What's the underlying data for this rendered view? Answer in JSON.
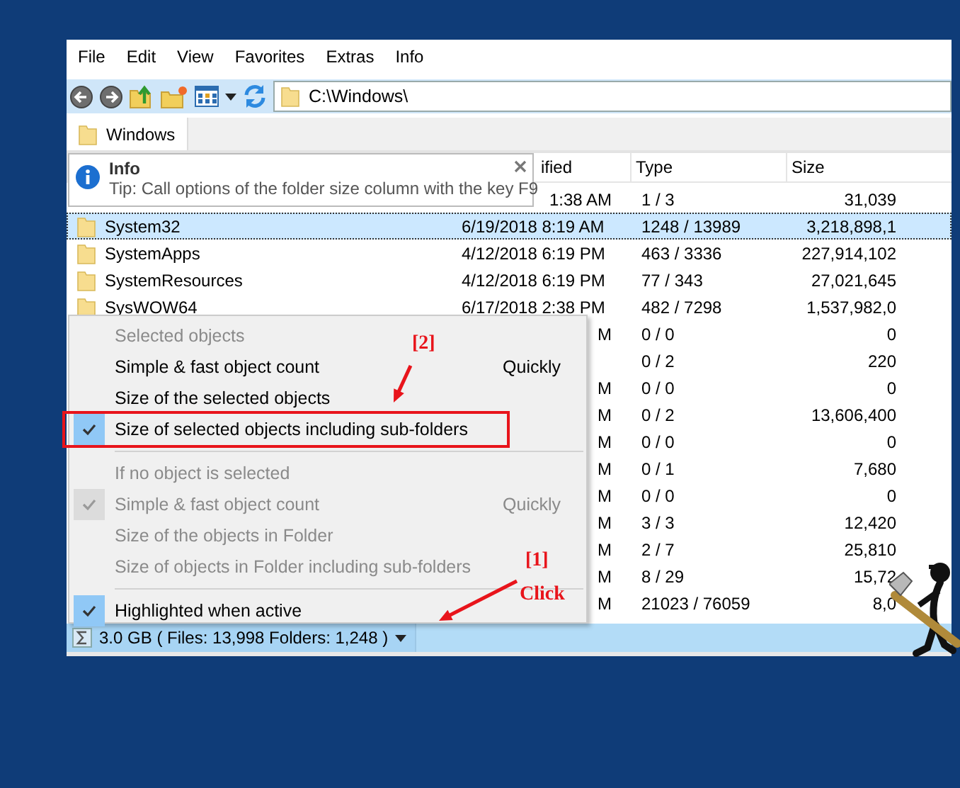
{
  "menu_bar": [
    {
      "label": "File"
    },
    {
      "label": "Edit"
    },
    {
      "label": "View"
    },
    {
      "label": "Favorites"
    },
    {
      "label": "Extras"
    },
    {
      "label": "Info"
    }
  ],
  "address_bar": {
    "value": "C:\\Windows\\"
  },
  "tabs": [
    {
      "label": "Windows",
      "selected": true
    }
  ],
  "info_tip": {
    "title": "Info",
    "text": "Tip: Call options of the folder size column with the key F9"
  },
  "file_list": {
    "columns": [
      {
        "label": "ified"
      },
      {
        "label": "Type"
      },
      {
        "label": "Size"
      }
    ],
    "rows": [
      {
        "kind": "covered",
        "modified": "1:38 AM",
        "type": "1 / 3",
        "size": "31,039",
        "selected": false
      },
      {
        "kind": "full",
        "name": "System32",
        "modified": "6/19/2018 8:19 AM",
        "type": "1248 / 13989",
        "size": "3,218,898,1",
        "selected": true
      },
      {
        "kind": "full",
        "name": "SystemApps",
        "modified": "4/12/2018 6:19 PM",
        "type": "463 / 3336",
        "size": "227,914,102",
        "selected": false
      },
      {
        "kind": "full",
        "name": "SystemResources",
        "modified": "4/12/2018 6:19 PM",
        "type": "77 / 343",
        "size": "27,021,645",
        "selected": false
      },
      {
        "kind": "full",
        "name": "SysWOW64",
        "modified": "6/17/2018 2:38 PM",
        "type": "482 / 7298",
        "size": "1,537,982,0",
        "selected": false
      },
      {
        "kind": "covered",
        "modified": "M",
        "type": "0 / 0",
        "size": "0",
        "selected": false
      },
      {
        "kind": "covered",
        "type": "0 / 2",
        "size": "220",
        "selected": false
      },
      {
        "kind": "covered",
        "modified": "M",
        "type": "0 / 0",
        "size": "0",
        "selected": false
      },
      {
        "kind": "covered",
        "modified": "M",
        "type": "0 / 2",
        "size": "13,606,400",
        "selected": false
      },
      {
        "kind": "covered",
        "modified": "M",
        "type": "0 / 0",
        "size": "0",
        "selected": false
      },
      {
        "kind": "covered",
        "modified": "M",
        "type": "0 / 1",
        "size": "7,680",
        "selected": false
      },
      {
        "kind": "covered",
        "modified": "M",
        "type": "0 / 0",
        "size": "0",
        "selected": false
      },
      {
        "kind": "covered",
        "modified": "M",
        "type": "3 / 3",
        "size": "12,420",
        "selected": false
      },
      {
        "kind": "covered",
        "modified": "M",
        "type": "2 / 7",
        "size": "25,810",
        "selected": false
      },
      {
        "kind": "covered",
        "modified": "M",
        "type": "8 / 29",
        "size": "15,72",
        "selected": false
      },
      {
        "kind": "covered",
        "modified": "M",
        "type": "21023 / 76059",
        "size": "8,0",
        "selected": false
      }
    ]
  },
  "context_menu": {
    "items": [
      {
        "kind": "header",
        "label": "Selected objects"
      },
      {
        "kind": "option",
        "label": "Simple & fast object count",
        "shortcut": "Quickly",
        "checked": false,
        "disabled": false,
        "marked": false
      },
      {
        "kind": "option",
        "label": "Size of the selected objects",
        "checked": false,
        "disabled": false,
        "marked": false
      },
      {
        "kind": "option",
        "label": "Size of selected objects including sub-folders",
        "checked": true,
        "disabled": false,
        "marked": true
      },
      {
        "kind": "separator"
      },
      {
        "kind": "header",
        "label": "If no object is selected"
      },
      {
        "kind": "option",
        "label": "Simple & fast object count",
        "shortcut": "Quickly",
        "checked": true,
        "disabled": true,
        "marked": false
      },
      {
        "kind": "option",
        "label": "Size of the objects in Folder",
        "checked": false,
        "disabled": true,
        "marked": false
      },
      {
        "kind": "option",
        "label": "Size of objects in Folder including sub-folders",
        "checked": false,
        "disabled": true,
        "marked": false
      },
      {
        "kind": "separator"
      },
      {
        "kind": "option",
        "label": "Highlighted when active",
        "checked": true,
        "disabled": false,
        "marked": false
      }
    ]
  },
  "annotations": [
    {
      "label": "[2]"
    },
    {
      "label": "[1]",
      "note": "Click"
    }
  ],
  "status_bar": {
    "summary": "3.0 GB ( Files: 13,998 Folders: 1,248 )"
  }
}
